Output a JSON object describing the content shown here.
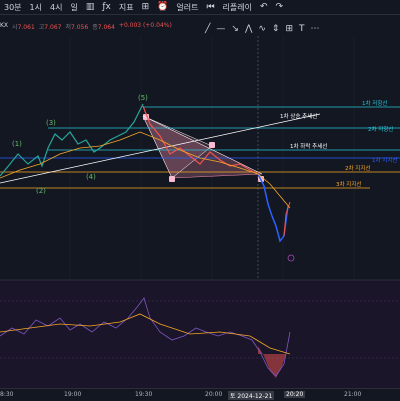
{
  "toolbar": {
    "intervals": [
      "30분",
      "1시",
      "4시"
    ],
    "interval_menu": "일",
    "indicator_label": "지표",
    "alerts_label": "얼러트",
    "replay_label": "리플레이",
    "undo_icon": "undo-icon",
    "redo_icon": "redo-icon"
  },
  "info": {
    "symbol": "KX",
    "open_label": "시",
    "open": "7.061",
    "high_label": "고",
    "high": "7.067",
    "low_label": "저",
    "low": "7.056",
    "close_label": "종",
    "close": "7.064",
    "change": "+0.003 (+0.04%)"
  },
  "chart": {
    "wave_labels": [
      "(1)",
      "(2)",
      "(3)",
      "(4)",
      "(5)"
    ],
    "lines": [
      {
        "label": "1차 저항선",
        "color": "#26c6da"
      },
      {
        "label": "1차 상승 추세선",
        "color": "#ffffff"
      },
      {
        "label": "2차 저항선",
        "color": "#26c6da"
      },
      {
        "label": "1차 하락 추세선",
        "color": "#ffffff"
      },
      {
        "label": "1차 지지선",
        "color": "#2962ff"
      },
      {
        "label": "2차 지지선",
        "color": "#f9a825"
      },
      {
        "label": "3차 지지선",
        "color": "#f9a825"
      }
    ]
  },
  "xaxis": {
    "labels": [
      "8:30",
      "19:00",
      "19:30",
      "20:00",
      "20:20",
      "21:00"
    ],
    "cursor_date": "토 2024-12-21"
  },
  "colors": {
    "background": "#131722",
    "up": "#26a69a",
    "down": "#ef5350",
    "candle_down": "#2962ff"
  }
}
